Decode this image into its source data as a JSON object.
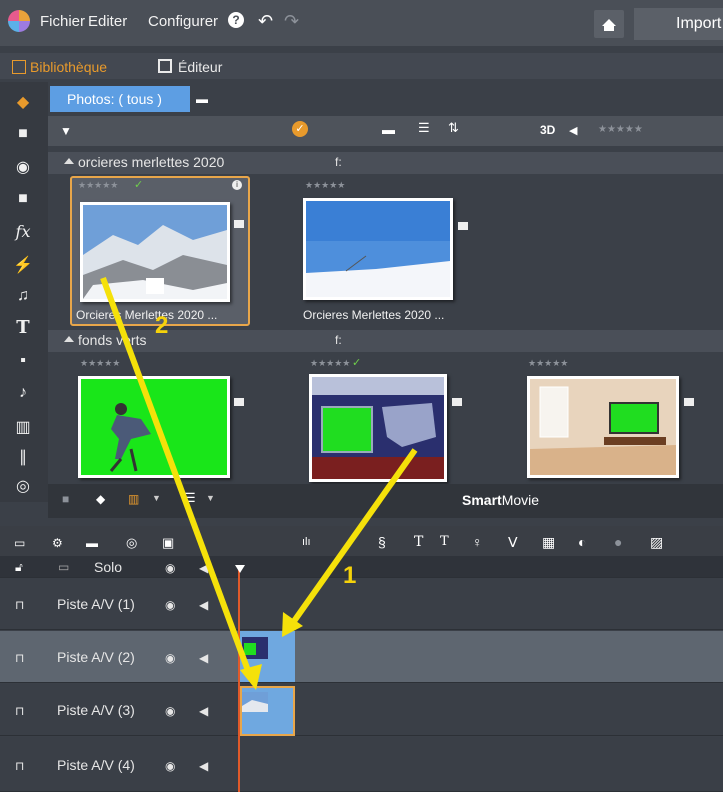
{
  "menu": {
    "items": [
      "Fichier",
      "Editer",
      "Configurer"
    ],
    "import_label": "Import"
  },
  "tabs": {
    "library": "Bibliothèque",
    "editor": "Éditeur"
  },
  "library": {
    "photo_tab": "Photos: ( tous )",
    "toolbar_3d": "3D",
    "groups": [
      {
        "name": "orcieres merlettes 2020",
        "path": "f:"
      },
      {
        "name": "fonds verts",
        "path": "f:"
      }
    ],
    "thumbs": [
      {
        "title": "Orcieres Merlettes 2020 ..."
      },
      {
        "title": "Orcieres Merlettes 2020 ..."
      }
    ],
    "smartmovie_bold": "Smart",
    "smartmovie_rest": "Movie"
  },
  "timeline": {
    "solo_label": "Solo",
    "tracks": [
      "Piste A/V (1)",
      "Piste A/V (2)",
      "Piste A/V (3)",
      "Piste A/V (4)"
    ]
  },
  "annotations": {
    "one": "1",
    "two": "2"
  }
}
